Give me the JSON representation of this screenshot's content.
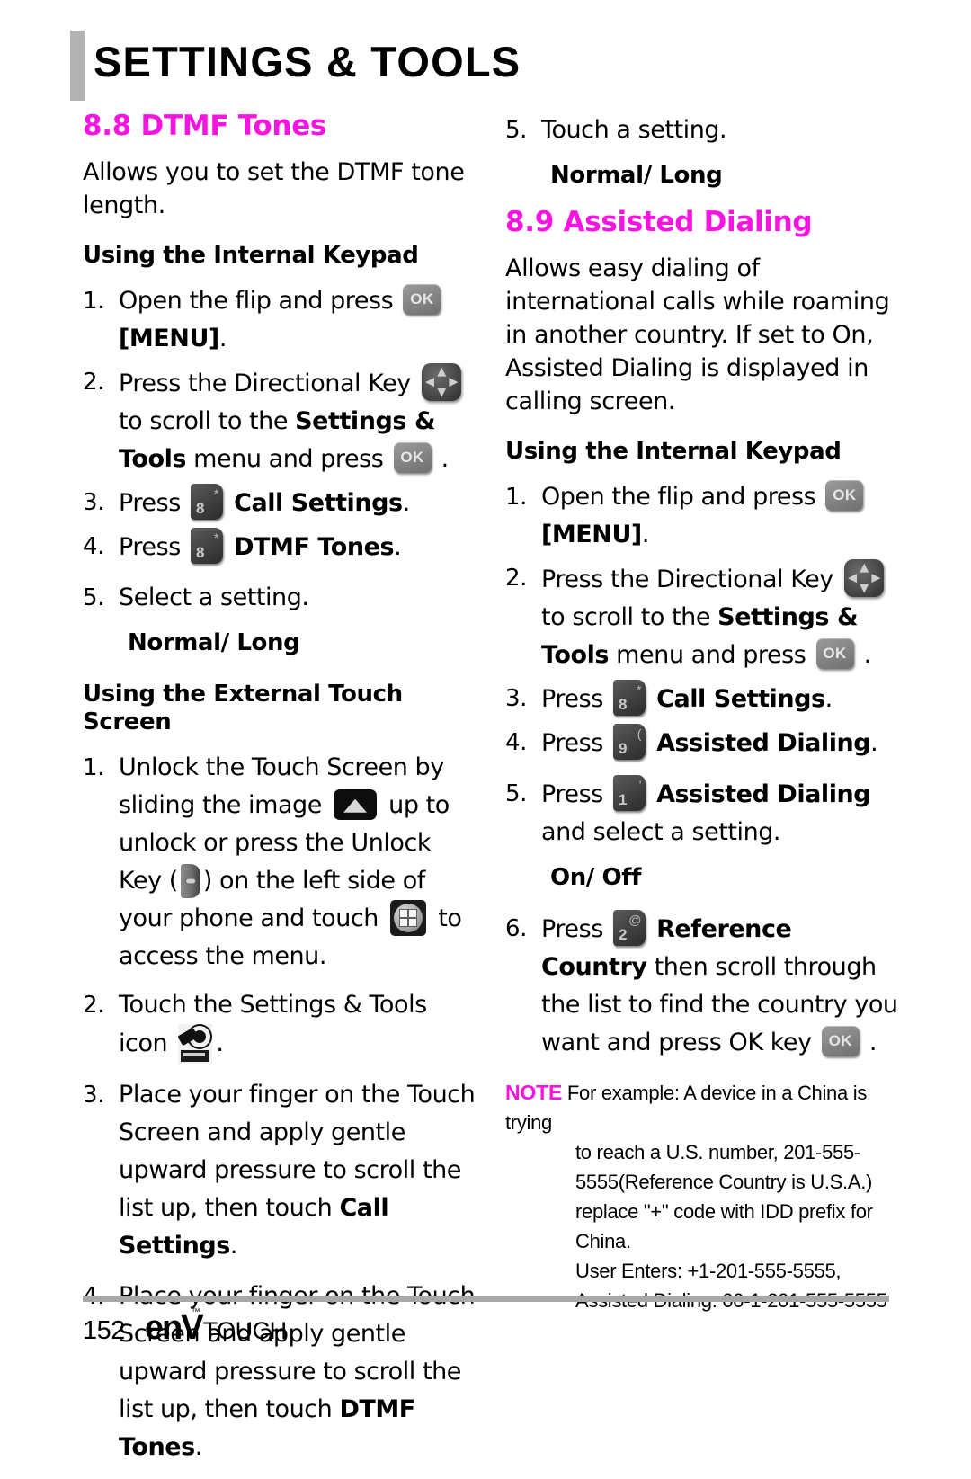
{
  "header": {
    "title": "SETTINGS & TOOLS"
  },
  "left": {
    "section": {
      "number_title": "8.8 DTMF Tones"
    },
    "intro": "Allows you to set the DTMF tone length.",
    "internal": {
      "heading": "Using the Internal Keypad",
      "step1_num": "1.",
      "step1_a": "Open the flip and press",
      "step1_b": "[MENU]",
      "step1_c": ".",
      "step2_num": "2.",
      "step2_a": "Press the Directional Key",
      "step2_b": "to scroll to the",
      "step2_c": "Settings & Tools",
      "step2_d": "menu and press",
      "step2_e": ".",
      "step3_num": "3.",
      "step3_a": "Press",
      "step3_b": "Call Settings",
      "step3_c": ".",
      "step3_key_digit": "8",
      "step3_key_symbol": "*",
      "step4_num": "4.",
      "step4_a": "Press",
      "step4_b": "DTMF Tones",
      "step4_c": ".",
      "step4_key_digit": "8",
      "step4_key_symbol": "*",
      "step5_num": "5.",
      "step5_a": "Select a setting.",
      "step5_options": "Normal/ Long"
    },
    "external": {
      "heading": "Using the External Touch Screen",
      "step1_num": "1.",
      "step1_a": "Unlock the Touch Screen by sliding the image",
      "step1_b": "up to unlock or press the Unlock Key",
      "step1_c": "(",
      "step1_d": ") on the left side of your phone and touch",
      "step1_e": "to access the menu.",
      "step2_num": "2.",
      "step2_a": "Touch the Settings & Tools icon",
      "step2_b": ".",
      "step3_num": "3.",
      "step3_a": "Place your finger on the Touch Screen and apply gentle upward pressure to scroll the list up, then touch",
      "step3_b": "Call Settings",
      "step3_c": ".",
      "step4_num": "4.",
      "step4_a": "Place your finger on the Touch Screen and apply gentle upward pressure to scroll the list up, then touch",
      "step4_b": "DTMF Tones",
      "step4_c": "."
    }
  },
  "right": {
    "top_step": {
      "num": "5.",
      "text": "Touch a setting.",
      "options": "Normal/ Long"
    },
    "section": {
      "number_title": "8.9 Assisted Dialing"
    },
    "intro": "Allows easy dialing of international calls while roaming in another country. If set to On, Assisted Dialing is displayed in calling screen.",
    "internal": {
      "heading": "Using the Internal Keypad",
      "step1_num": "1.",
      "step1_a": "Open the flip and press",
      "step1_b": "[MENU]",
      "step1_c": ".",
      "step2_num": "2.",
      "step2_a": "Press the Directional Key",
      "step2_b": "to scroll to the",
      "step2_c": "Settings & Tools",
      "step2_d": "menu and press",
      "step2_e": ".",
      "step3_num": "3.",
      "step3_a": "Press",
      "step3_b": "Call Settings",
      "step3_c": ".",
      "step3_key_digit": "8",
      "step3_key_symbol": "*",
      "step4_num": "4.",
      "step4_a": "Press",
      "step4_b": "Assisted Dialing",
      "step4_c": ".",
      "step4_key_digit": "9",
      "step4_key_symbol": "(",
      "step5_num": "5.",
      "step5_a": "Press",
      "step5_b": "Assisted Dialing",
      "step5_c": "and select a setting.",
      "step5_key_digit": "1",
      "step5_key_symbol": "'",
      "step5_options": "On/ Off",
      "step6_num": "6.",
      "step6_a": "Press",
      "step6_b": "Reference Country",
      "step6_c": "then scroll through the list to find the country you want and press OK key",
      "step6_d": ".",
      "step6_key_digit": "2",
      "step6_key_symbol": "@"
    },
    "note": {
      "label": "NOTE",
      "line1": "For example: A device in a China is trying",
      "line2": "to reach a U.S. number, 201-555-",
      "line3": "5555(Reference Country is U.S.A.)",
      "line4": "replace \"+\" code with IDD prefix for",
      "line5": "China.",
      "line6": "User Enters: +1-201-555-5555,",
      "line7": "Assisted Dialing: 00-1-201-555-5555"
    }
  },
  "footer": {
    "page_number": "152",
    "logo_primary": "enV",
    "logo_secondary": "TOUCH",
    "logo_trademark": "™"
  },
  "colors": {
    "accent": "#f714e0",
    "header_bar": "#b3b3b3",
    "footer_rule": "#a8a8a8"
  },
  "key_labels": {
    "ok": "OK"
  }
}
